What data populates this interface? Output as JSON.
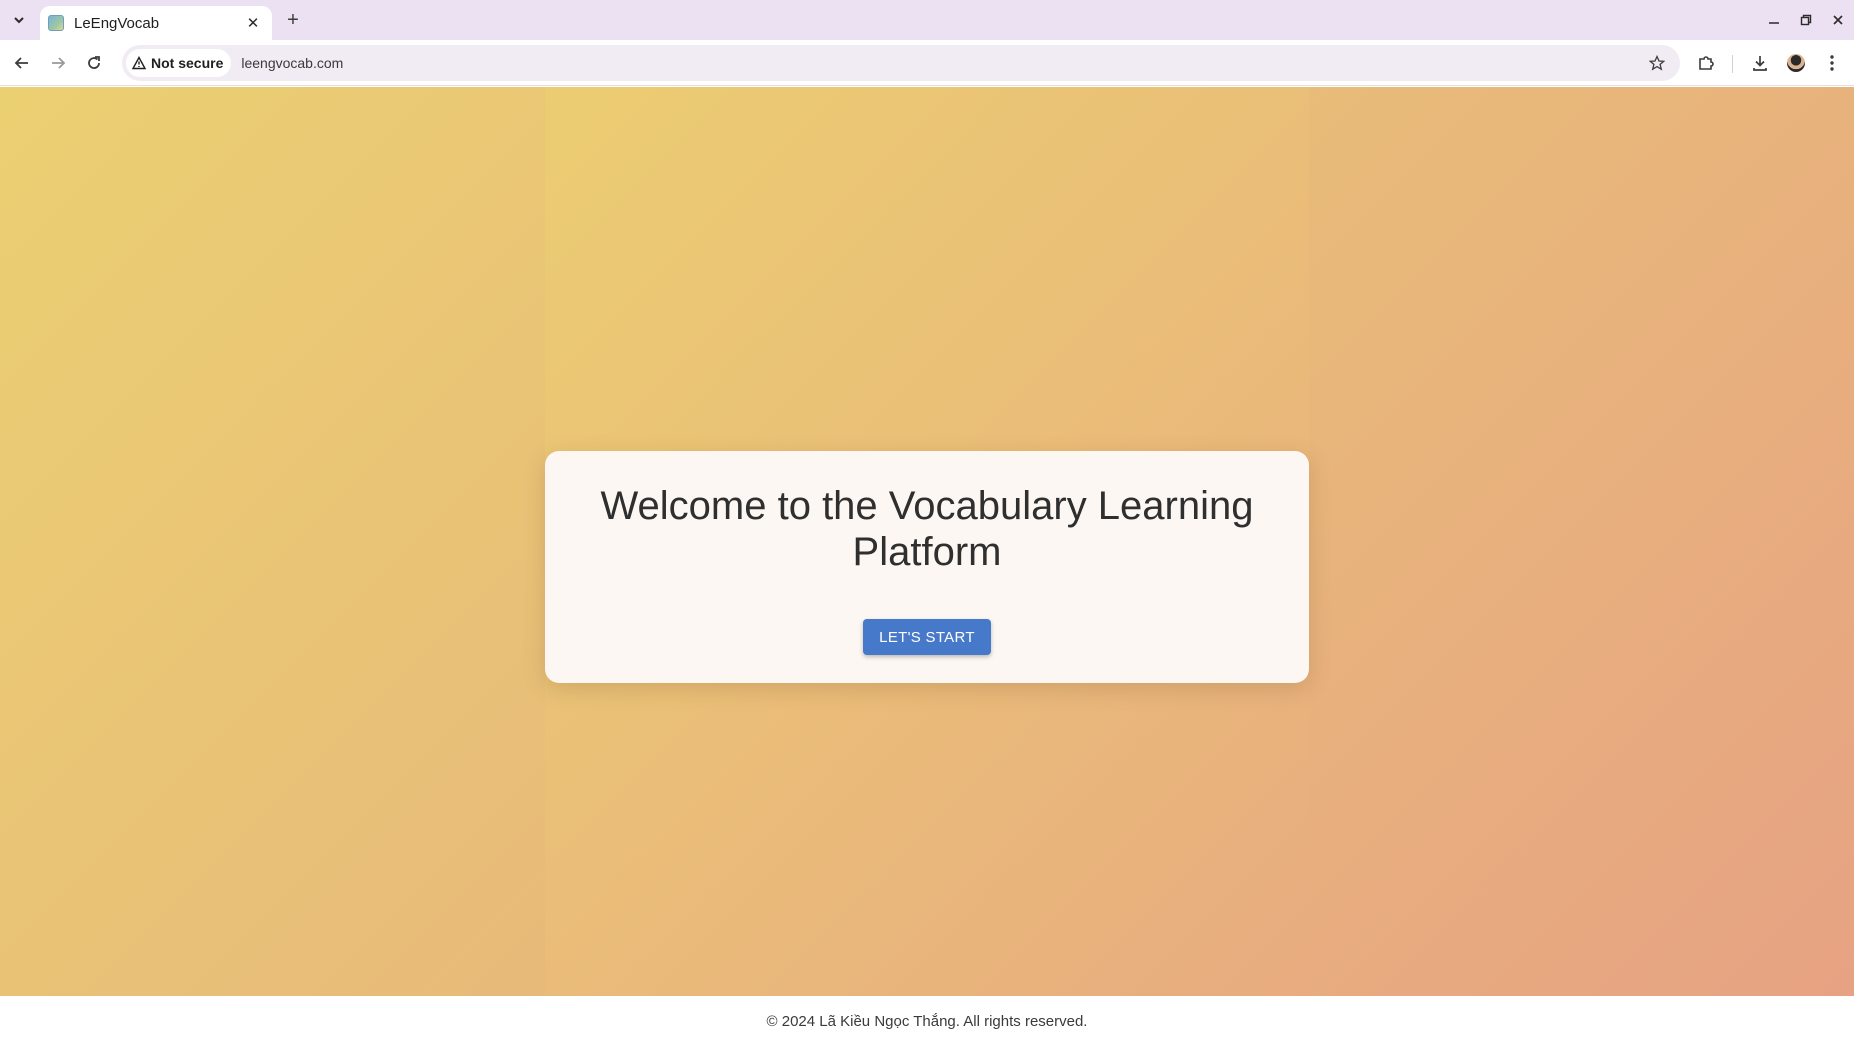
{
  "browser": {
    "tab": {
      "title": "LeEngVocab",
      "close": "✕"
    },
    "new_tab": "+",
    "window": {
      "minimize": "–",
      "restore": "❐",
      "close": "✕"
    },
    "toolbar": {
      "security_label": "Not secure",
      "url": "leengvocab.com"
    },
    "icons": {
      "tab_search": "chevron-down-icon",
      "back": "arrow-left-icon",
      "forward": "arrow-right-icon",
      "reload": "reload-icon",
      "warning": "warning-icon",
      "bookmark": "star-icon",
      "extensions": "puzzle-icon",
      "downloads": "download-icon",
      "profile": "avatar-icon",
      "menu": "kebab-menu-icon"
    }
  },
  "page": {
    "heading": "Welcome to the Vocabulary Learning Platform",
    "start_button": "LET'S START",
    "footer": "© 2024 Lã Kiều Ngọc Thắng. All rights reserved."
  },
  "colors": {
    "tabbar": "#ece0f3",
    "button": "#4679c9",
    "gradient_start": "#ebd072",
    "gradient_end": "#e7a283",
    "card": "#fcf7f2"
  }
}
